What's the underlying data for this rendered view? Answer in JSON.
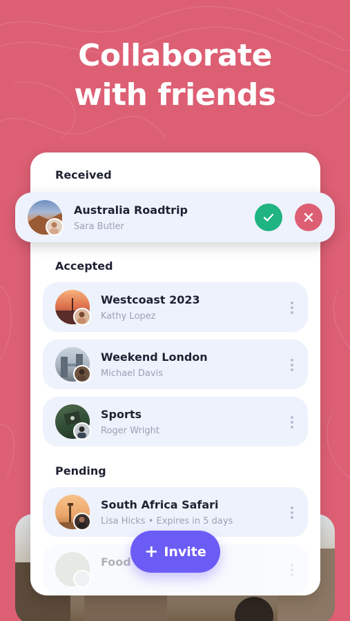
{
  "headline": [
    "Collaborate",
    "with friends"
  ],
  "sections": {
    "received": "Received",
    "accepted": "Accepted",
    "pending": "Pending"
  },
  "received_item": {
    "title": "Australia Roadtrip",
    "subtitle": "Sara Butler"
  },
  "accepted_items": [
    {
      "title": "Westcoast 2023",
      "subtitle": "Kathy Lopez"
    },
    {
      "title": "Weekend London",
      "subtitle": "Michael Davis"
    },
    {
      "title": "Sports",
      "subtitle": "Roger Wright"
    }
  ],
  "pending_items": [
    {
      "title": "South Africa Safari",
      "subtitle": "Lisa Hicks • Expires in 5 days"
    },
    {
      "title": "Food",
      "subtitle": ""
    }
  ],
  "invite": {
    "label": "Invite"
  },
  "colors": {
    "background": "#dd5f74",
    "accept": "#1fb482",
    "decline": "#dd5f74",
    "invite": "#6c5cf6",
    "row": "#eef2fc"
  },
  "icons": {
    "accept": "check-icon",
    "decline": "close-icon",
    "more": "more-vertical-icon",
    "add": "plus-icon"
  }
}
